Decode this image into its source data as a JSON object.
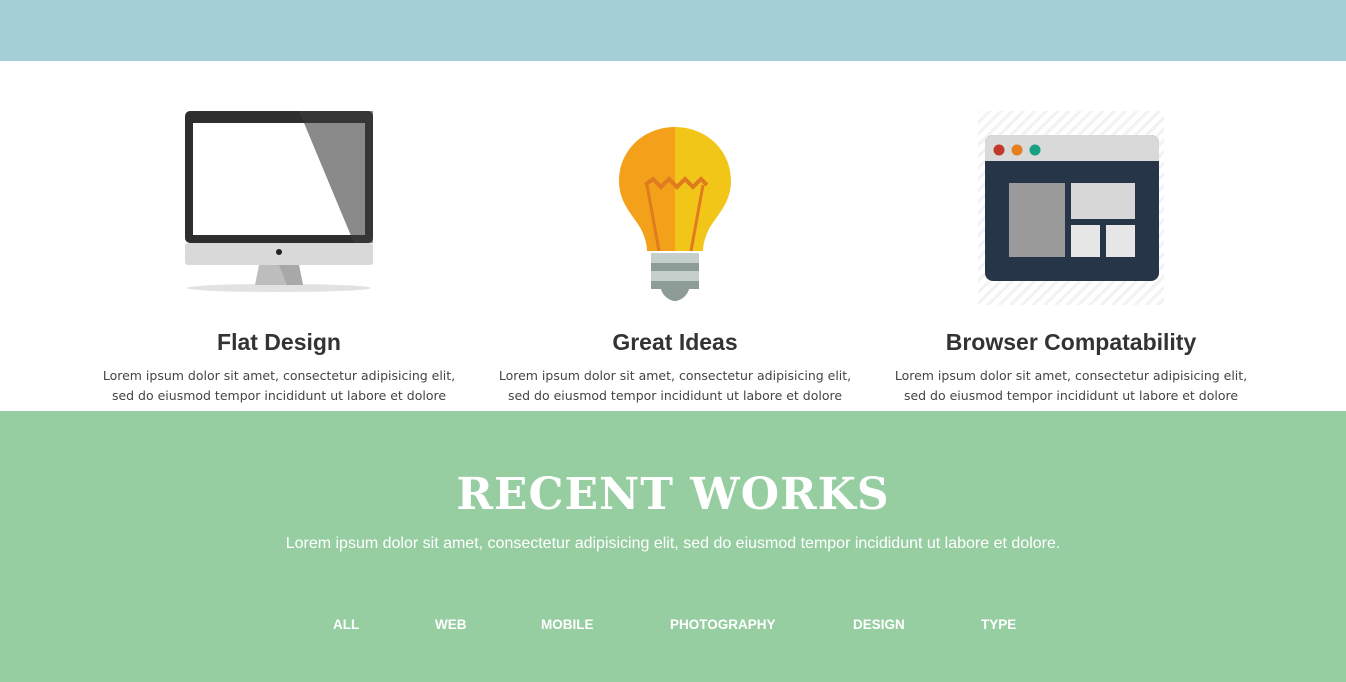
{
  "features": [
    {
      "title": "Flat Design",
      "text": "Lorem ipsum dolor sit amet, consectetur adipisicing elit, sed do eiusmod tempor incididunt ut labore et dolore magna.",
      "icon": "monitor-icon"
    },
    {
      "title": "Great Ideas",
      "text": "Lorem ipsum dolor sit amet, consectetur adipisicing elit, sed do eiusmod tempor incididunt ut labore et dolore magna.",
      "icon": "lightbulb-icon"
    },
    {
      "title": "Browser Compatability",
      "text": "Lorem ipsum dolor sit amet, consectetur adipisicing elit, sed do eiusmod tempor incididunt ut labore et dolore magna.",
      "icon": "browser-window-icon"
    }
  ],
  "recent": {
    "title": "RECENT WORKS",
    "subtitle": "Lorem ipsum dolor sit amet, consectetur adipisicing elit, sed do eiusmod tempor incididunt ut labore et dolore.",
    "filters": [
      "ALL",
      "WEB",
      "MOBILE",
      "PHOTOGRAPHY",
      "DESIGN",
      "TYPE"
    ]
  },
  "colors": {
    "top_bar": "#a5d0d8",
    "recent_bg": "#96cea2",
    "heading_text": "#333333"
  }
}
